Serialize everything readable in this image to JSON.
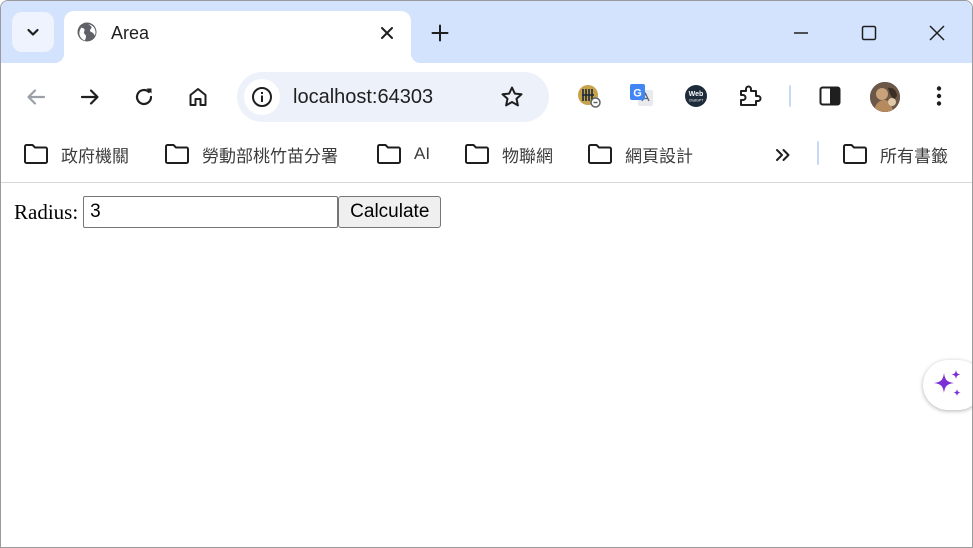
{
  "tab": {
    "title": "Area"
  },
  "omnibox": {
    "url": "localhost:64303"
  },
  "bookmarks": {
    "items": [
      {
        "label": "政府機關"
      },
      {
        "label": "勞動部桃竹苗分署"
      },
      {
        "label": "AI"
      },
      {
        "label": "物聯網"
      },
      {
        "label": "網頁設計"
      }
    ],
    "all_bookmarks_label": "所有書籤"
  },
  "form": {
    "radius_label": "Radius:",
    "radius_value": "3",
    "calculate_label": "Calculate"
  },
  "colors": {
    "tabstrip_bg": "#d3e3fd",
    "omnibox_bg": "#edf2fa",
    "sparkle_purple": "#7b2fd4"
  },
  "icons": {
    "tab_search": "chevron-down-icon",
    "favicon": "globe-icon",
    "tab_close": "close-icon",
    "new_tab": "plus-icon",
    "minimize": "minimize-icon",
    "maximize": "maximize-icon",
    "close_window": "close-icon",
    "back": "arrow-left-icon",
    "forward": "arrow-right-icon",
    "reload": "reload-icon",
    "home": "home-icon",
    "site_info": "info-icon",
    "bookmark_star": "star-icon",
    "extensions": [
      "keeper-icon",
      "google-translate-icon",
      "webchatgpt-icon",
      "puzzle-icon"
    ],
    "side_panel": "side-panel-icon",
    "menu": "kebab-menu-icon",
    "folder": "folder-icon",
    "more_bookmarks": "double-chevron-right-icon",
    "assistant": "sparkle-icon"
  }
}
